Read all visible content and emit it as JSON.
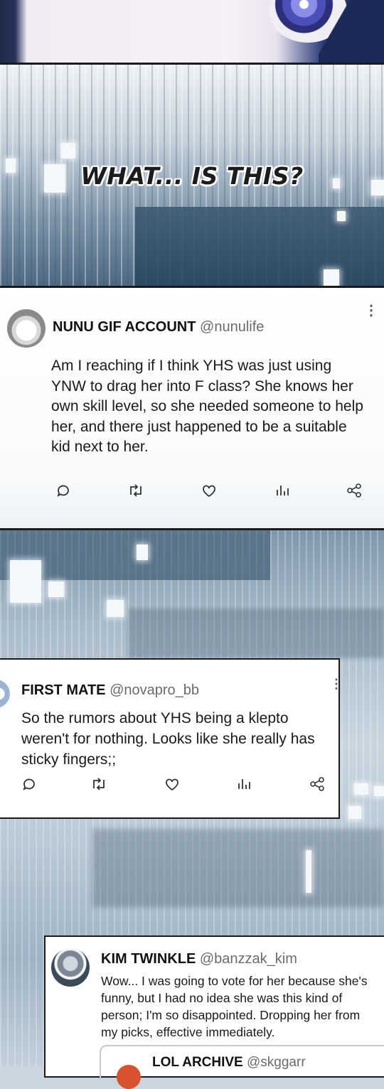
{
  "caption": "WHAT... IS THIS?",
  "tweets": [
    {
      "name": "NUNU GIF ACCOUNT",
      "handle": "@nunulife",
      "text": "Am I reaching if I think YHS was just using YNW to drag her into F class? She knows her own skill level, so she needed someone to help her, and there just happened to be a suitable kid next to her."
    },
    {
      "name": "FIRST MATE",
      "handle": "@novapro_bb",
      "text": "So the rumors about YHS being a klepto weren't for nothing. Looks like she really has sticky fingers;;"
    },
    {
      "name": "KIM TWINKLE",
      "handle": "@banzzak_kim",
      "text": "Wow... I was going to vote for her because she's funny, but I had no idea she was this kind of person; I'm so disappointed. Dropping her from my picks, effective immediately."
    }
  ],
  "quoted": {
    "name": "LOL ARCHIVE",
    "handle": "@skggarr"
  },
  "actions": [
    "reply-icon",
    "retweet-icon",
    "like-icon",
    "views-icon",
    "share-icon"
  ],
  "colors": {
    "panel_dark": "#294660",
    "border": "#1b1b1b"
  }
}
